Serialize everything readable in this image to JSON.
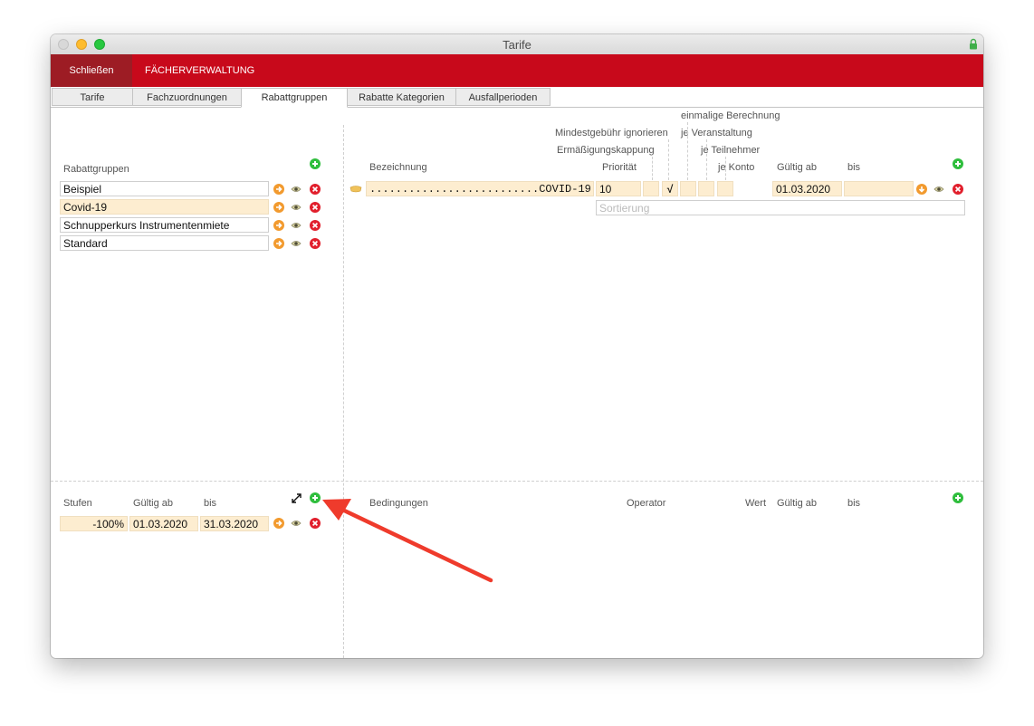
{
  "window": {
    "title": "Tarife"
  },
  "toolbar": {
    "close_label": "Schließen",
    "nav_label": "FÄCHERVERWALTUNG"
  },
  "tabs": [
    {
      "label": "Tarife"
    },
    {
      "label": "Fachzuordnungen"
    },
    {
      "label": "Rabattgruppen"
    },
    {
      "label": "Rabatte Kategorien"
    },
    {
      "label": "Ausfallperioden"
    }
  ],
  "rabattgruppen": {
    "header": "Rabattgruppen",
    "items": [
      "Beispiel",
      "Covid-19",
      "Schnupperkurs Instrumentenmiete",
      "Standard"
    ]
  },
  "rabatte": {
    "headers": {
      "bezeichnung": "Bezeichnung",
      "prioritaet": "Priorität",
      "ermaessigung": "Ermäßigungskappung",
      "mindest": "Mindestgebühr ignorieren",
      "einmalig": "einmalige Berechnung",
      "veranstaltung": "je Veranstaltung",
      "teilnehmer": "je Teilnehmer",
      "konto": "je Konto",
      "gueltig_ab": "Gültig ab",
      "bis": "bis"
    },
    "row": {
      "bezeichnung": "..........................COVID-19",
      "prioritaet": "10",
      "check": "√",
      "gueltig_ab": "01.03.2020",
      "bis": ""
    },
    "sortierung_placeholder": "Sortierung"
  },
  "stufen": {
    "headers": {
      "stufen": "Stufen",
      "gueltig_ab": "Gültig ab",
      "bis": "bis"
    },
    "row": {
      "value": "-100%",
      "gueltig_ab": "01.03.2020",
      "bis": "31.03.2020"
    }
  },
  "bedingungen": {
    "headers": {
      "bedingungen": "Bedingungen",
      "operator": "Operator",
      "wert": "Wert",
      "gueltig_ab": "Gültig ab",
      "bis": "bis"
    }
  },
  "colors": {
    "brand_red": "#c8091b",
    "active_red": "#9d1c24",
    "highlight": "#fdedd0",
    "arrow": "#ef3b2c"
  }
}
